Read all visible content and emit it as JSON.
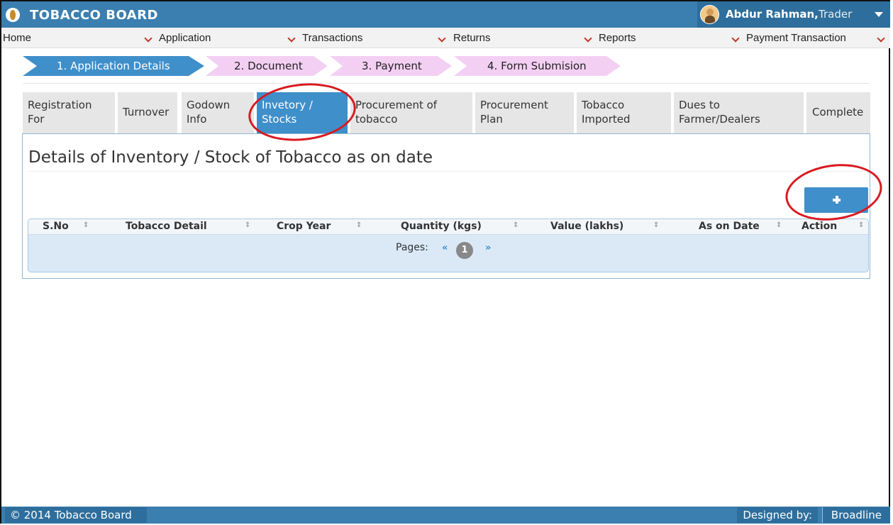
{
  "header": {
    "brand": "TOBACCO BOARD",
    "user_name": "Abdur Rahman,",
    "user_role": "Trader"
  },
  "menu": [
    "Home",
    "Application",
    "Transactions",
    "Returns",
    "Reports",
    "Payment Transaction"
  ],
  "steps": [
    "1. Application Details",
    "2. Document",
    "3. Payment",
    "4. Form Submision"
  ],
  "tabs": [
    {
      "line1": "Registration",
      "line2": "For"
    },
    {
      "line1": "Turnover",
      "line2": ""
    },
    {
      "line1": "Godown",
      "line2": "Info"
    },
    {
      "line1": "Invetory /",
      "line2": "Stocks"
    },
    {
      "line1": "Procurement of",
      "line2": "tobacco"
    },
    {
      "line1": "Procurement",
      "line2": "Plan"
    },
    {
      "line1": "Tobacco",
      "line2": "Imported"
    },
    {
      "line1": "Dues to",
      "line2": "Farmer/Dealers"
    },
    {
      "line1": "Complete",
      "line2": ""
    }
  ],
  "panel": {
    "title": "Details of Inventory / Stock of Tobacco as on date",
    "add_button": "+"
  },
  "table": {
    "columns": [
      "S.No",
      "Tobacco Detail",
      "Crop Year",
      "Quantity (kgs)",
      "Value (lakhs)",
      "As on Date",
      "Action"
    ],
    "rows": [],
    "pages_label": "Pages:",
    "prev": "«",
    "current_page": "1",
    "next": "»"
  },
  "footer": {
    "copyright": "© 2014 Tobacco Board",
    "designed_by": "Designed by:",
    "company": "Broadline"
  },
  "colors": {
    "header_blue": "#3a7fb0",
    "active_blue": "#3f8fca",
    "step_pink": "#f3d0f3",
    "annotation_red": "#d8191f"
  }
}
